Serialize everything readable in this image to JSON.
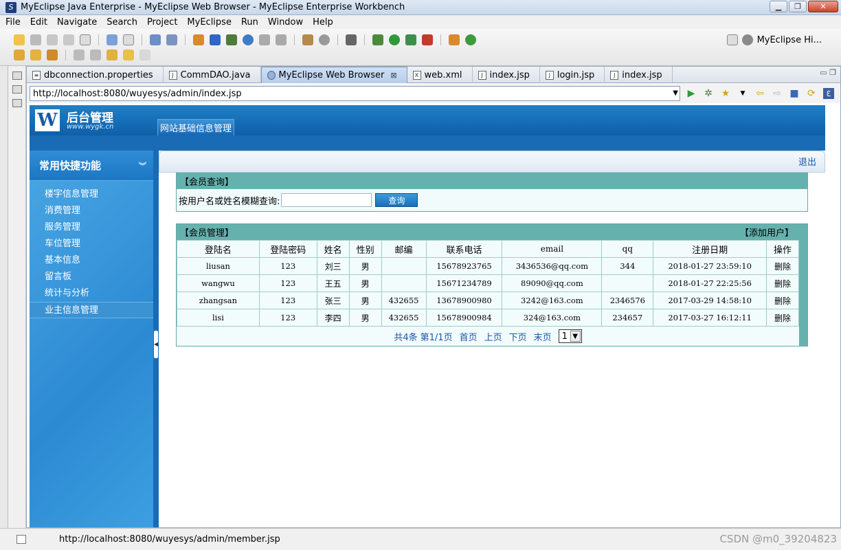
{
  "window": {
    "title": "MyEclipse Java Enterprise - MyEclipse Web Browser - MyEclipse Enterprise Workbench"
  },
  "menu": [
    "File",
    "Edit",
    "Navigate",
    "Search",
    "Project",
    "MyEclipse",
    "Run",
    "Window",
    "Help"
  ],
  "perspective": {
    "label": "MyEclipse Hi..."
  },
  "tabs": [
    {
      "label": "dbconnection.properties",
      "icon": "properties-file-icon",
      "active": false
    },
    {
      "label": "CommDAO.java",
      "icon": "java-file-icon",
      "active": false
    },
    {
      "label": "MyEclipse Web Browser",
      "icon": "globe-icon",
      "active": true
    },
    {
      "label": "web.xml",
      "icon": "xml-file-icon",
      "active": false
    },
    {
      "label": "index.jsp",
      "icon": "jsp-file-icon",
      "active": false
    },
    {
      "label": "login.jsp",
      "icon": "jsp-file-icon",
      "active": false
    },
    {
      "label": "index.jsp",
      "icon": "jsp-file-icon",
      "active": false
    }
  ],
  "browser": {
    "url": "http://localhost:8080/wuyesys/admin/index.jsp"
  },
  "site": {
    "logo_letter": "W",
    "logo_title": "后台管理",
    "logo_sub": "www.wygk.cn",
    "topnav": "网站基础信息管理",
    "logout": "退出"
  },
  "sidebar": {
    "title": "常用快捷功能",
    "items": [
      "楼宇信息管理",
      "消费管理",
      "服务管理",
      "车位管理",
      "基本信息",
      "留言板",
      "统计与分析",
      "业主信息管理"
    ],
    "active_index": 7
  },
  "search_panel": {
    "title": "【会员查询】",
    "label": "按用户名或姓名模糊查询:",
    "input_value": "",
    "button": "查询"
  },
  "member_panel": {
    "title": "【会员管理】",
    "add_label": "【添加用户】",
    "headers": [
      "登陆名",
      "登陆密码",
      "姓名",
      "性别",
      "邮编",
      "联系电话",
      "email",
      "qq",
      "注册日期",
      "操作"
    ],
    "rows": [
      [
        "liusan",
        "123",
        "刘三",
        "男",
        "",
        "15678923765",
        "3436536@qq.com",
        "344",
        "2018-01-27 23:59:10",
        "删除"
      ],
      [
        "wangwu",
        "123",
        "王五",
        "男",
        "",
        "15671234789",
        "89090@qq.com",
        "",
        "2018-01-27 22:25:56",
        "删除"
      ],
      [
        "zhangsan",
        "123",
        "张三",
        "男",
        "432655",
        "13678900980",
        "3242@163.com",
        "2346576",
        "2017-03-29 14:58:10",
        "删除"
      ],
      [
        "lisi",
        "123",
        "李四",
        "男",
        "432655",
        "15678900984",
        "324@163.com",
        "234657",
        "2017-03-27 16:12:11",
        "删除"
      ]
    ],
    "pager": {
      "total": "共4条",
      "page": "第1/1页",
      "first": "首页",
      "prev": "上页",
      "next": "下页",
      "last": "末页",
      "select": "1"
    }
  },
  "status": {
    "text": "http://localhost:8080/wuyesys/admin/member.jsp",
    "watermark": "CSDN @m0_39204823"
  },
  "colors": {
    "header_blue": "#1f7fc7",
    "sidebar_blue": "#3d9fe0",
    "panel_teal": "#65b1ae",
    "link_blue": "#1a56a8"
  }
}
